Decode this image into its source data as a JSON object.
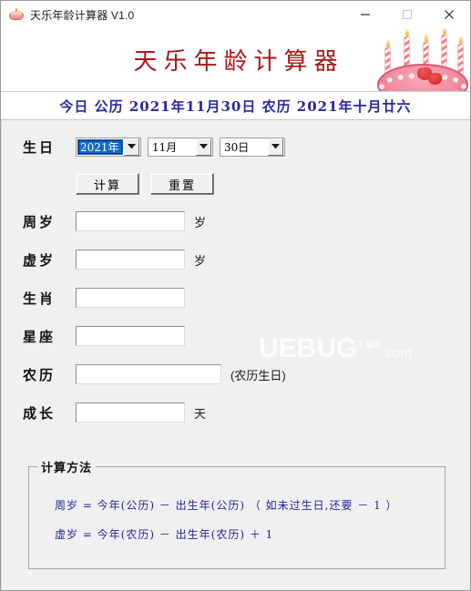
{
  "window": {
    "title": "天乐年龄计算器 V1.0",
    "icon": "cake-icon",
    "controls": {
      "minimize": "minimize-icon",
      "maximize": "maximize-icon",
      "close": "close-icon"
    }
  },
  "banner": {
    "title": "天乐年龄计算器",
    "title_color": "#a81818",
    "image": "birthday-cake-photo"
  },
  "today": {
    "text": "今日  公历  2021年11月30日  农历  2021年十月廿六",
    "color": "#2727a5"
  },
  "watermark": {
    "main": "UEBUG",
    "tag": "下载站",
    "suffix": ".com"
  },
  "form": {
    "birthday": {
      "label": "生日",
      "year": "2021年",
      "month": "11月",
      "day": "30日"
    },
    "buttons": {
      "calculate": "计算",
      "reset": "重置"
    },
    "fields": [
      {
        "label": "周岁",
        "value": "",
        "unit": "岁"
      },
      {
        "label": "虚岁",
        "value": "",
        "unit": "岁"
      },
      {
        "label": "生肖",
        "value": "",
        "unit": ""
      },
      {
        "label": "星座",
        "value": "",
        "unit": ""
      },
      {
        "label": "农历",
        "value": "",
        "unit": "(农历生日)"
      },
      {
        "label": "成长",
        "value": "",
        "unit": "天"
      }
    ]
  },
  "method": {
    "legend": "计算方法",
    "line1": "周岁 =  今年(公历)  －  出生年(公历)  （ 如未过生日,还要 － 1 ）",
    "line2": "虚岁 =  今年(农历)  －  出生年(农历)  ＋  1"
  }
}
